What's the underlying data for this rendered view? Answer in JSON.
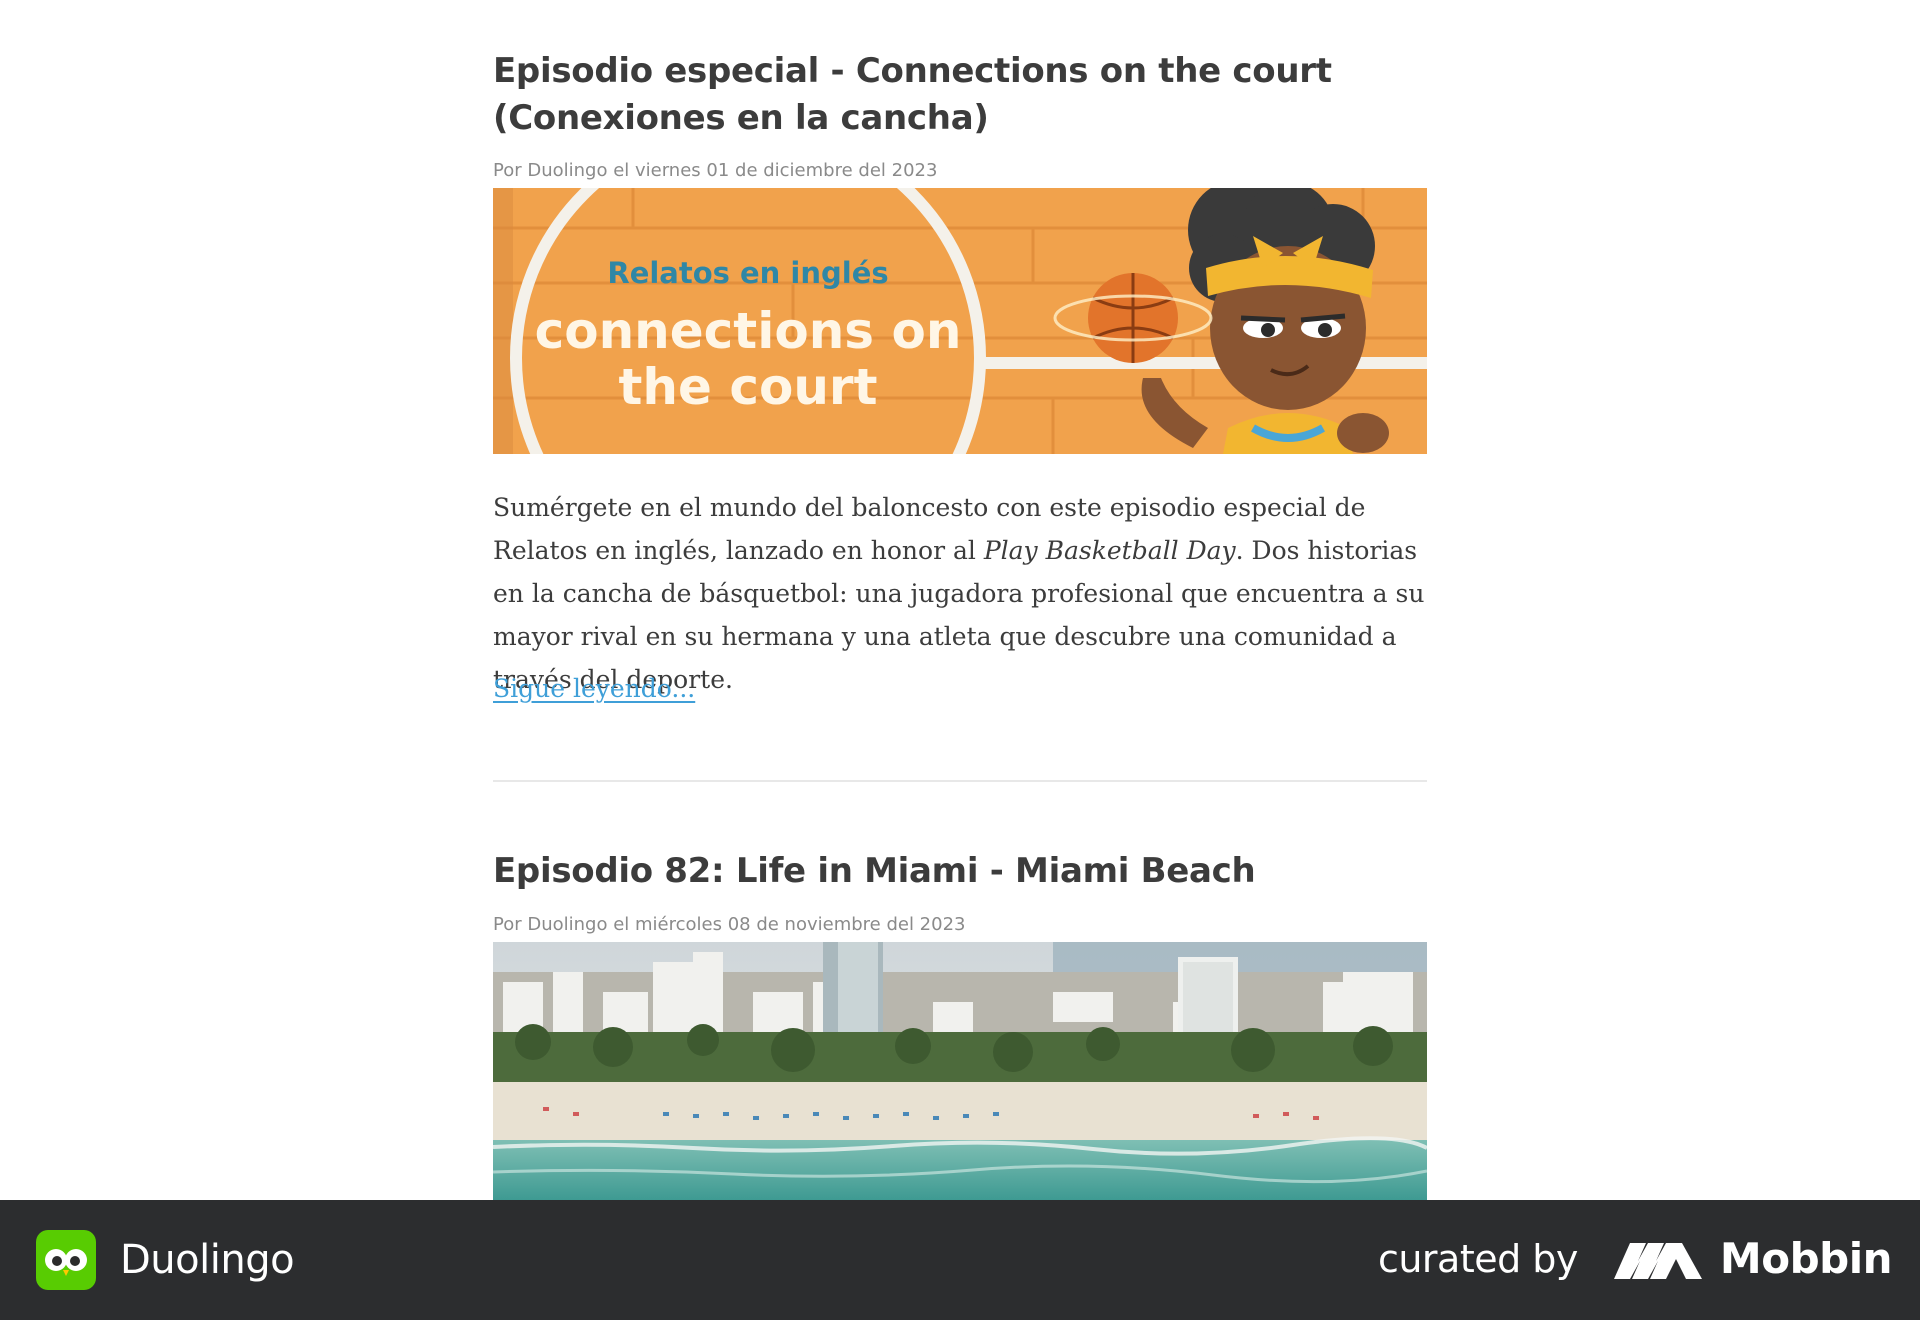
{
  "posts": [
    {
      "title_line1": "Episodio especial - Connections on the court",
      "title_line2": "(Conexiones en la cancha)",
      "meta": "Por Duolingo el viernes 01 de diciembre del 2023",
      "image_label_top": "Relatos en inglés",
      "image_label_line1": "connections on",
      "image_label_line2": "the court",
      "body_part1": "Sumérgete en el mundo del baloncesto con este episodio especial de Relatos en inglés, lanzado en honor al ",
      "body_emphasis": "Play Basketball Day",
      "body_part2": ". Dos historias en la cancha de básquetbol: una jugadora profesional que encuentra a su mayor rival en su hermana y una atleta que descubre una comunidad a través del deporte.",
      "read_more": "Sigue leyendo..."
    },
    {
      "title": "Episodio 82: Life in Miami - Miami Beach",
      "meta": "Por Duolingo el miércoles 08 de noviembre del 2023"
    }
  ],
  "footer": {
    "app_name": "Duolingo",
    "curated_by": "curated by",
    "curator": "Mobbin"
  },
  "colors": {
    "link": "#3f9fd8",
    "footer_bg": "#2c2d2f",
    "duolingo_green": "#58cc02",
    "court_orange": "#f0a04b"
  },
  "icons": [
    "duolingo-owl-icon",
    "mobbin-logo-icon"
  ]
}
